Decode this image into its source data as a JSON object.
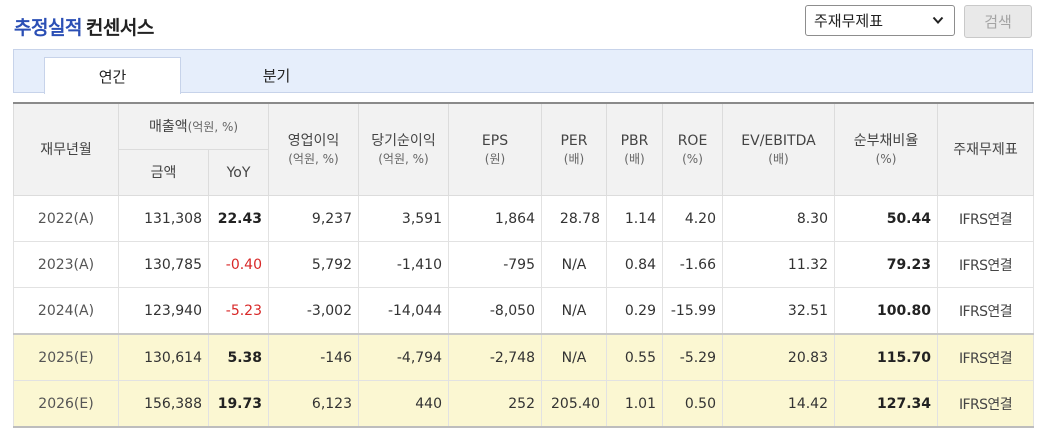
{
  "header": {
    "title_strong": "추정실적",
    "title_rest": "컨센서스",
    "select_value": "주재무제표",
    "search_label": "검색"
  },
  "tabs": [
    {
      "label": "연간",
      "active": true
    },
    {
      "label": "분기",
      "active": false
    }
  ],
  "columns": {
    "period": "재무년월",
    "sales_group": "매출액",
    "sales_group_unit": "(억원, %)",
    "sales_amount": "금액",
    "sales_yoy": "YoY",
    "op": "영업이익",
    "op_unit": "(억원, %)",
    "net": "당기순이익",
    "net_unit": "(억원, %)",
    "eps": "EPS",
    "eps_unit": "(원)",
    "per": "PER",
    "per_unit": "(배)",
    "pbr": "PBR",
    "pbr_unit": "(배)",
    "roe": "ROE",
    "roe_unit": "(%)",
    "ev": "EV/EBITDA",
    "ev_unit": "(배)",
    "debt": "순부채비율",
    "debt_unit": "(%)",
    "fs": "주재무제표"
  },
  "rows": [
    {
      "period": "2022(A)",
      "sales": "131,308",
      "yoy": "22.43",
      "op": "9,237",
      "net": "3,591",
      "eps": "1,864",
      "per": "28.78",
      "pbr": "1.14",
      "roe": "4.20",
      "ev": "8.30",
      "debt": "50.44",
      "fs": "IFRS연결"
    },
    {
      "period": "2023(A)",
      "sales": "130,785",
      "yoy": "-0.40",
      "op": "5,792",
      "net": "-1,410",
      "eps": "-795",
      "per": "N/A",
      "pbr": "0.84",
      "roe": "-1.66",
      "ev": "11.32",
      "debt": "79.23",
      "fs": "IFRS연결"
    },
    {
      "period": "2024(A)",
      "sales": "123,940",
      "yoy": "-5.23",
      "op": "-3,002",
      "net": "-14,044",
      "eps": "-8,050",
      "per": "N/A",
      "pbr": "0.29",
      "roe": "-15.99",
      "ev": "32.51",
      "debt": "100.80",
      "fs": "IFRS연결"
    },
    {
      "period": "2025(E)",
      "sales": "130,614",
      "yoy": "5.38",
      "op": "-146",
      "net": "-4,794",
      "eps": "-2,748",
      "per": "N/A",
      "pbr": "0.55",
      "roe": "-5.29",
      "ev": "20.83",
      "debt": "115.70",
      "fs": "IFRS연결"
    },
    {
      "period": "2026(E)",
      "sales": "156,388",
      "yoy": "19.73",
      "op": "6,123",
      "net": "440",
      "eps": "252",
      "per": "205.40",
      "pbr": "1.01",
      "roe": "0.50",
      "ev": "14.42",
      "debt": "127.34",
      "fs": "IFRS연결"
    }
  ],
  "colors": {
    "title_accent": "#2b4fb5",
    "negative": "#d82828",
    "estimate_row_bg": "#fbf7d2",
    "tabbar_bg": "#e6eefb"
  },
  "icons": {
    "select_arrow": "chevron-down-icon"
  }
}
